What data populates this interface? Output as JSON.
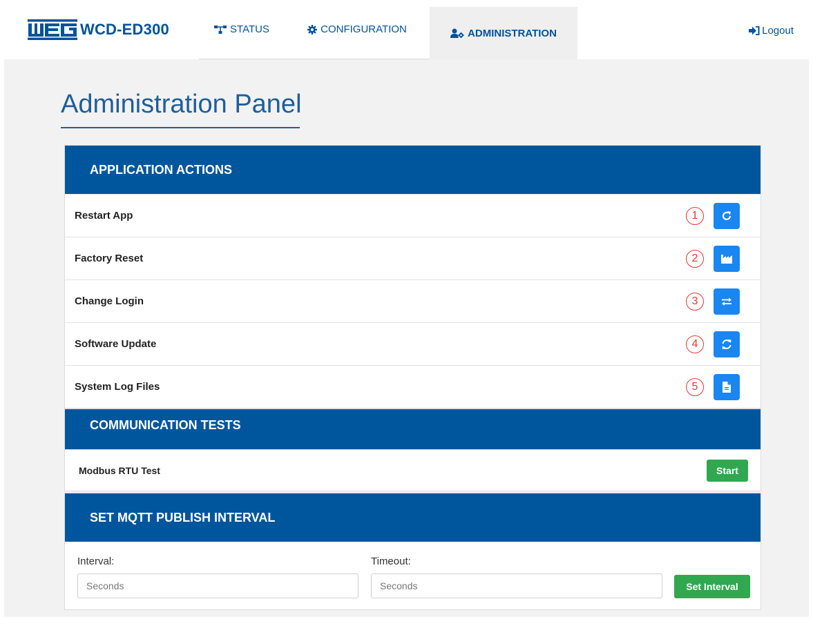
{
  "brand": {
    "title": "WCD-ED300",
    "logo_text": "WEG"
  },
  "nav": {
    "status": "STATUS",
    "configuration": "CONFIGURATION",
    "administration": "ADMINISTRATION",
    "logout": "Logout"
  },
  "page": {
    "title": "Administration Panel"
  },
  "application_actions": {
    "header": "APPLICATION ACTIONS",
    "items": [
      {
        "label": "Restart App",
        "number": "1",
        "icon": "redo-icon"
      },
      {
        "label": "Factory Reset",
        "number": "2",
        "icon": "industry-icon"
      },
      {
        "label": "Change Login",
        "number": "3",
        "icon": "exchange-icon"
      },
      {
        "label": "Software Update",
        "number": "4",
        "icon": "sync-icon"
      },
      {
        "label": "System Log Files",
        "number": "5",
        "icon": "file-icon"
      }
    ]
  },
  "communication_tests": {
    "header": "COMMUNICATION TESTS",
    "modbus_label": "Modbus RTU Test",
    "start_label": "Start"
  },
  "mqtt": {
    "header": "SET MQTT PUBLISH INTERVAL",
    "interval_label": "Interval:",
    "interval_placeholder": "Seconds",
    "timeout_label": "Timeout:",
    "timeout_placeholder": "Seconds",
    "set_label": "Set Interval"
  },
  "colors": {
    "brand_blue": "#00569c",
    "action_blue": "#1a86f2",
    "success_green": "#2fa84f",
    "annotation_red": "#e53935"
  }
}
